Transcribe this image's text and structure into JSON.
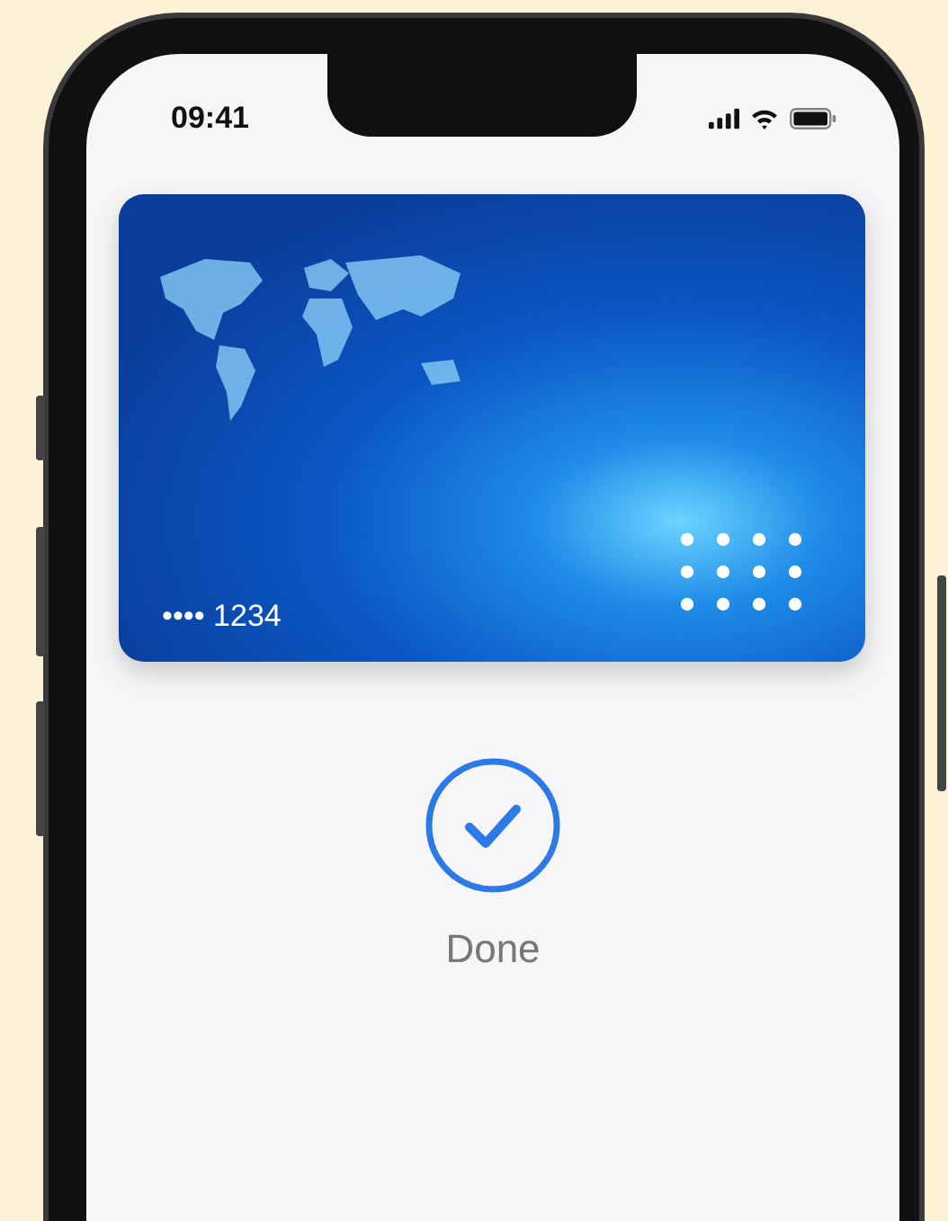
{
  "status_bar": {
    "time": "09:41"
  },
  "card": {
    "number": "•••• 1234"
  },
  "result": {
    "label": "Done"
  }
}
